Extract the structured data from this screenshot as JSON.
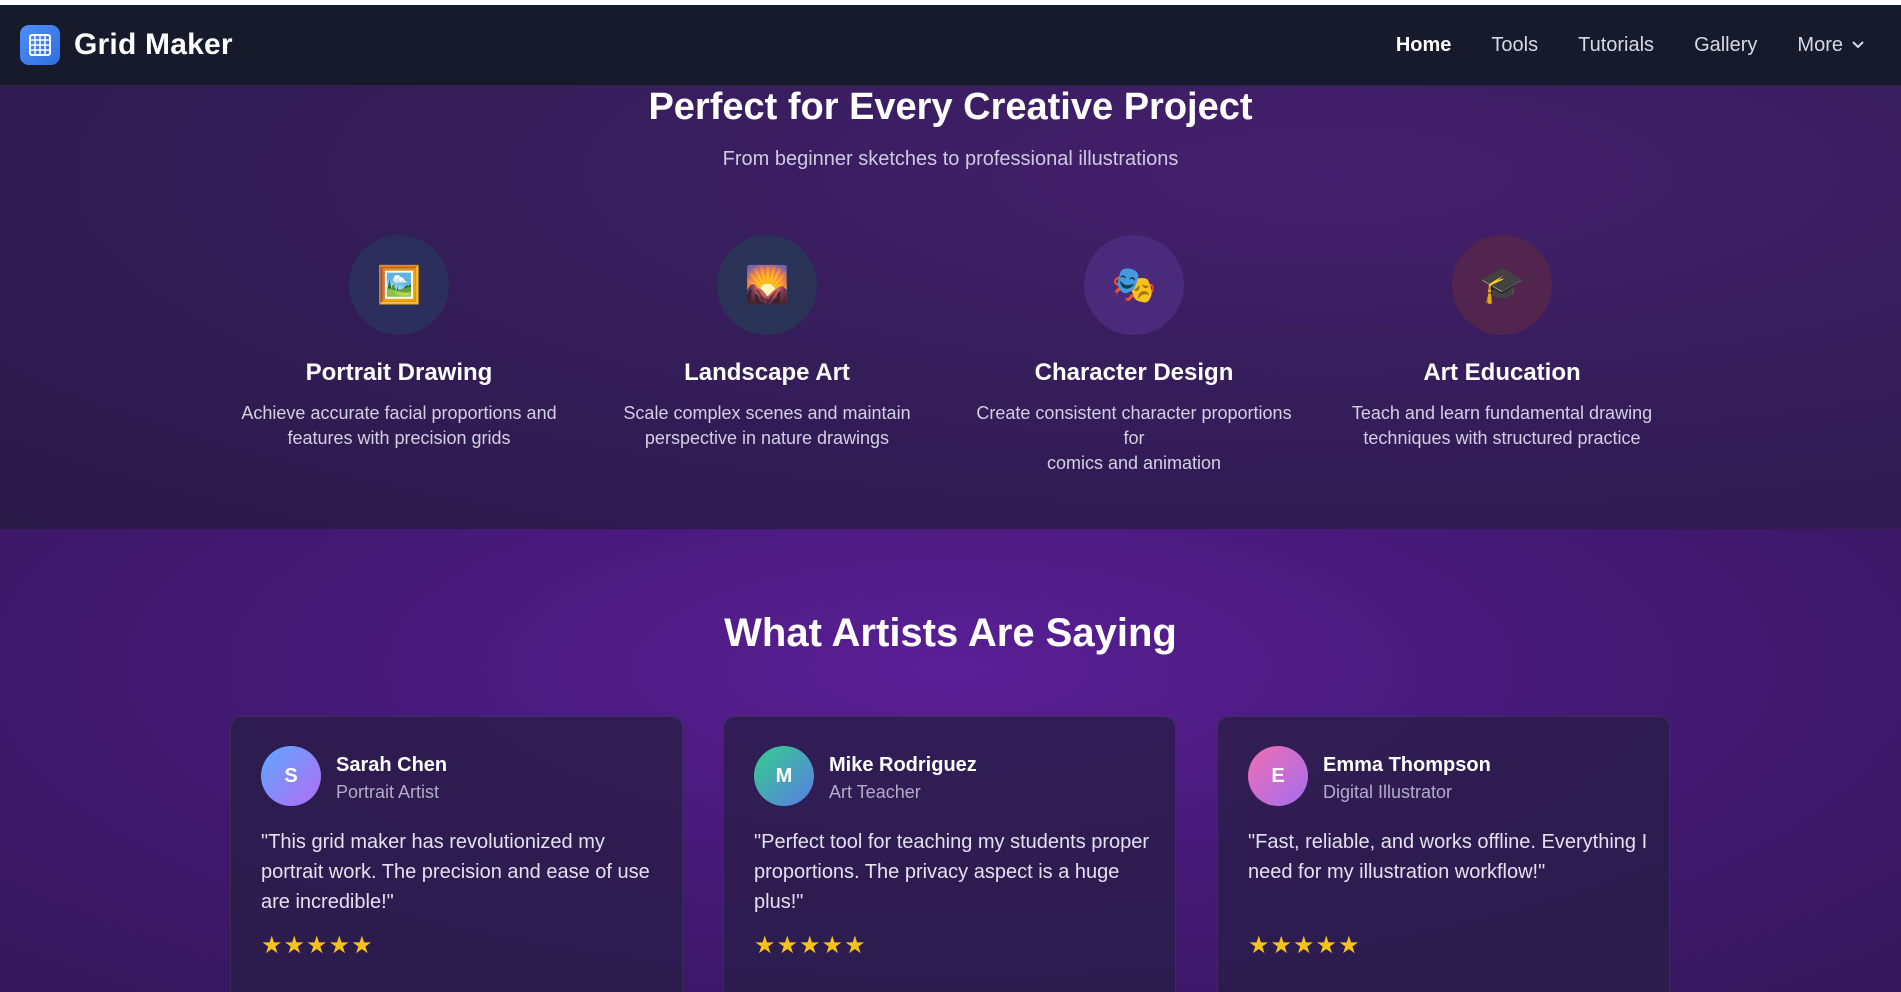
{
  "navbar": {
    "brand": "Grid Maker",
    "links": [
      "Home",
      "Tools",
      "Tutorials",
      "Gallery"
    ],
    "more_label": "More",
    "active": "Home"
  },
  "use_cases": {
    "title": "Perfect for Every Creative Project",
    "subtitle": "From beginner sketches to professional illustrations",
    "items": [
      {
        "icon": "framed-picture-icon",
        "emoji": "🖼️",
        "title": "Portrait Drawing",
        "desc_line1": "Achieve accurate facial proportions and",
        "desc_line2": "features with precision grids",
        "color": "#2c2f5c"
      },
      {
        "icon": "landscape-icon",
        "emoji": "🌄",
        "title": "Landscape Art",
        "desc_line1": "Scale complex scenes and maintain",
        "desc_line2": "perspective in nature drawings",
        "color": "#2b3357"
      },
      {
        "icon": "theater-masks-icon",
        "emoji": "🎭",
        "title": "Character Design",
        "desc_line1": "Create consistent character proportions for",
        "desc_line2": "comics and animation",
        "color": "#4a2a7a"
      },
      {
        "icon": "graduation-cap-icon",
        "emoji": "🎓",
        "title": "Art Education",
        "desc_line1": "Teach and learn fundamental drawing",
        "desc_line2": "techniques with structured practice",
        "color": "#52254f"
      }
    ]
  },
  "testimonials": {
    "title": "What Artists Are Saying",
    "items": [
      {
        "initial": "S",
        "name": "Sarah Chen",
        "role": "Portrait Artist",
        "quote": "\"This grid maker has revolutionized my portrait work. The precision and ease of use are incredible!\"",
        "stars": "★★★★★",
        "gradient": [
          "#5ea8ff",
          "#b36cf5"
        ]
      },
      {
        "initial": "M",
        "name": "Mike Rodriguez",
        "role": "Art Teacher",
        "quote": "\"Perfect tool for teaching my students proper proportions. The privacy aspect is a huge plus!\"",
        "stars": "★★★★★",
        "gradient": [
          "#34d08a",
          "#5b7be8"
        ]
      },
      {
        "initial": "E",
        "name": "Emma Thompson",
        "role": "Digital Illustrator",
        "quote": "\"Fast, reliable, and works offline. Everything I need for my illustration workflow!\"",
        "stars": "★★★★★",
        "gradient": [
          "#f06fb0",
          "#a36df0"
        ]
      }
    ]
  }
}
